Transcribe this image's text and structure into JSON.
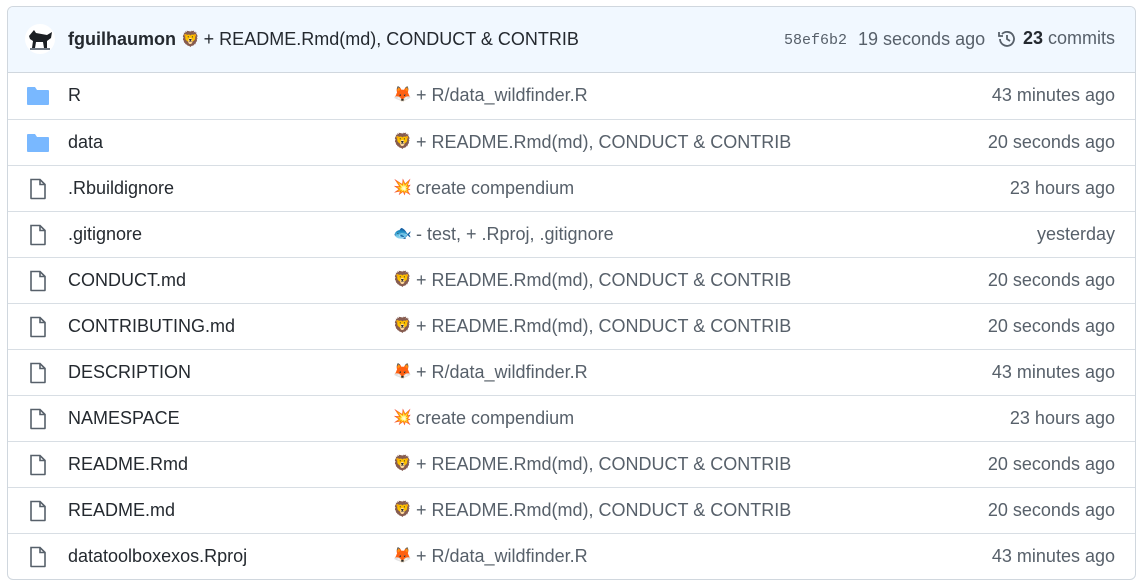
{
  "header": {
    "author": "fguilhaumon",
    "emoji": "🦁",
    "message": "+ README.Rmd(md), CONDUCT & CONTRIB",
    "sha": "58ef6b2",
    "time": "19 seconds ago",
    "commit_count": "23",
    "commits_label": "commits"
  },
  "files": [
    {
      "type": "folder",
      "name": "R",
      "emoji": "🦊",
      "message": "+ R/data_wildfinder.R",
      "time": "43 minutes ago"
    },
    {
      "type": "folder",
      "name": "data",
      "emoji": "🦁",
      "message": "+ README.Rmd(md), CONDUCT & CONTRIB",
      "time": "20 seconds ago"
    },
    {
      "type": "file",
      "name": ".Rbuildignore",
      "emoji": "💥",
      "message": "create compendium",
      "time": "23 hours ago"
    },
    {
      "type": "file",
      "name": ".gitignore",
      "emoji": "🐟",
      "message": "- test, + .Rproj, .gitignore",
      "time": "yesterday"
    },
    {
      "type": "file",
      "name": "CONDUCT.md",
      "emoji": "🦁",
      "message": "+ README.Rmd(md), CONDUCT & CONTRIB",
      "time": "20 seconds ago"
    },
    {
      "type": "file",
      "name": "CONTRIBUTING.md",
      "emoji": "🦁",
      "message": "+ README.Rmd(md), CONDUCT & CONTRIB",
      "time": "20 seconds ago"
    },
    {
      "type": "file",
      "name": "DESCRIPTION",
      "emoji": "🦊",
      "message": "+ R/data_wildfinder.R",
      "time": "43 minutes ago"
    },
    {
      "type": "file",
      "name": "NAMESPACE",
      "emoji": "💥",
      "message": "create compendium",
      "time": "23 hours ago"
    },
    {
      "type": "file",
      "name": "README.Rmd",
      "emoji": "🦁",
      "message": "+ README.Rmd(md), CONDUCT & CONTRIB",
      "time": "20 seconds ago"
    },
    {
      "type": "file",
      "name": "README.md",
      "emoji": "🦁",
      "message": "+ README.Rmd(md), CONDUCT & CONTRIB",
      "time": "20 seconds ago"
    },
    {
      "type": "file",
      "name": "datatoolboxexos.Rproj",
      "emoji": "🦊",
      "message": "+ R/data_wildfinder.R",
      "time": "43 minutes ago"
    }
  ],
  "colors": {
    "folder": "#79b8ff",
    "file_icon": "#57606a",
    "header_bg": "#f1f8ff",
    "muted_text": "#57606a"
  }
}
